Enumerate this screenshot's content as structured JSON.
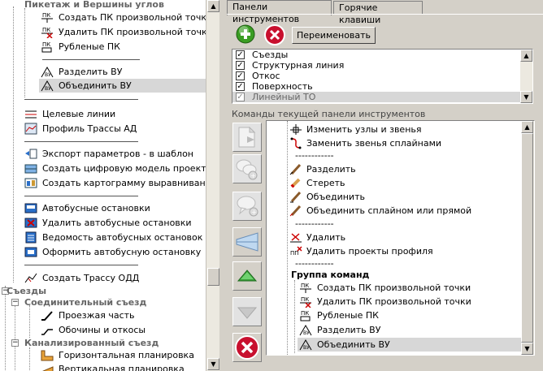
{
  "tree": {
    "items": [
      {
        "label": "Пикетаж и Вершины углов"
      },
      {
        "label": "Создать ПК произвольной точки"
      },
      {
        "label": "Удалить ПК произвольной точки"
      },
      {
        "label": "Рубленые ПК"
      },
      {
        "label": "Разделить ВУ"
      },
      {
        "label": "Объединить ВУ"
      },
      {
        "label": "Целевые линии"
      },
      {
        "label": "Профиль Трассы АД"
      },
      {
        "label": "Экспорт параметров - в шаблон"
      },
      {
        "label": "Создать цифровую модель проекта"
      },
      {
        "label": "Создать картограмму выравнивания"
      },
      {
        "label": "Автобусные остановки"
      },
      {
        "label": "Удалить автобусные остановки"
      },
      {
        "label": "Ведомость автобусных остановок"
      },
      {
        "label": "Оформить автобусную остановку"
      },
      {
        "label": "Создать Трассу ОДД"
      },
      {
        "label": "Съезды"
      },
      {
        "label": "Соединительный съезд"
      },
      {
        "label": "Проезжая часть"
      },
      {
        "label": "Обочины и откосы"
      },
      {
        "label": "Канализированный съезд"
      },
      {
        "label": "Горизонтальная планировка"
      },
      {
        "label": "Вертикальная планировка"
      }
    ]
  },
  "tabs": [
    {
      "label": "Панели инструментов"
    },
    {
      "label": "Горячие клавиши"
    }
  ],
  "toolbar": {
    "rename_label": "Переименовать"
  },
  "panels_list": [
    {
      "label": "Съезды",
      "checked": true
    },
    {
      "label": "Структурная линия",
      "checked": true
    },
    {
      "label": "Откос",
      "checked": true
    },
    {
      "label": "Поверхность",
      "checked": true
    },
    {
      "label": "Линейный ТО",
      "checked": true
    }
  ],
  "commands_header": "Команды текущей панели инструментов",
  "commands": [
    {
      "label": "Изменить узлы и звенья"
    },
    {
      "label": "Заменить звенья сплайнами"
    },
    {
      "label": "------------"
    },
    {
      "label": "Разделить"
    },
    {
      "label": "Стереть"
    },
    {
      "label": "Объединить"
    },
    {
      "label": "Объединить сплайном или прямой"
    },
    {
      "label": "------------"
    },
    {
      "label": "Удалить"
    },
    {
      "label": "Удалить проекты профиля"
    },
    {
      "label": "------------"
    },
    {
      "label": "Группа команд"
    },
    {
      "label": "Создать ПК произвольной точки"
    },
    {
      "label": "Удалить ПК произвольной точки"
    },
    {
      "label": "Рубленые ПК"
    },
    {
      "label": "Разделить ВУ"
    },
    {
      "label": "Объединить ВУ"
    }
  ],
  "colors": {
    "selection": "#d7d7d7",
    "add_green": "#3a9d23",
    "delete_red": "#c8102e"
  }
}
